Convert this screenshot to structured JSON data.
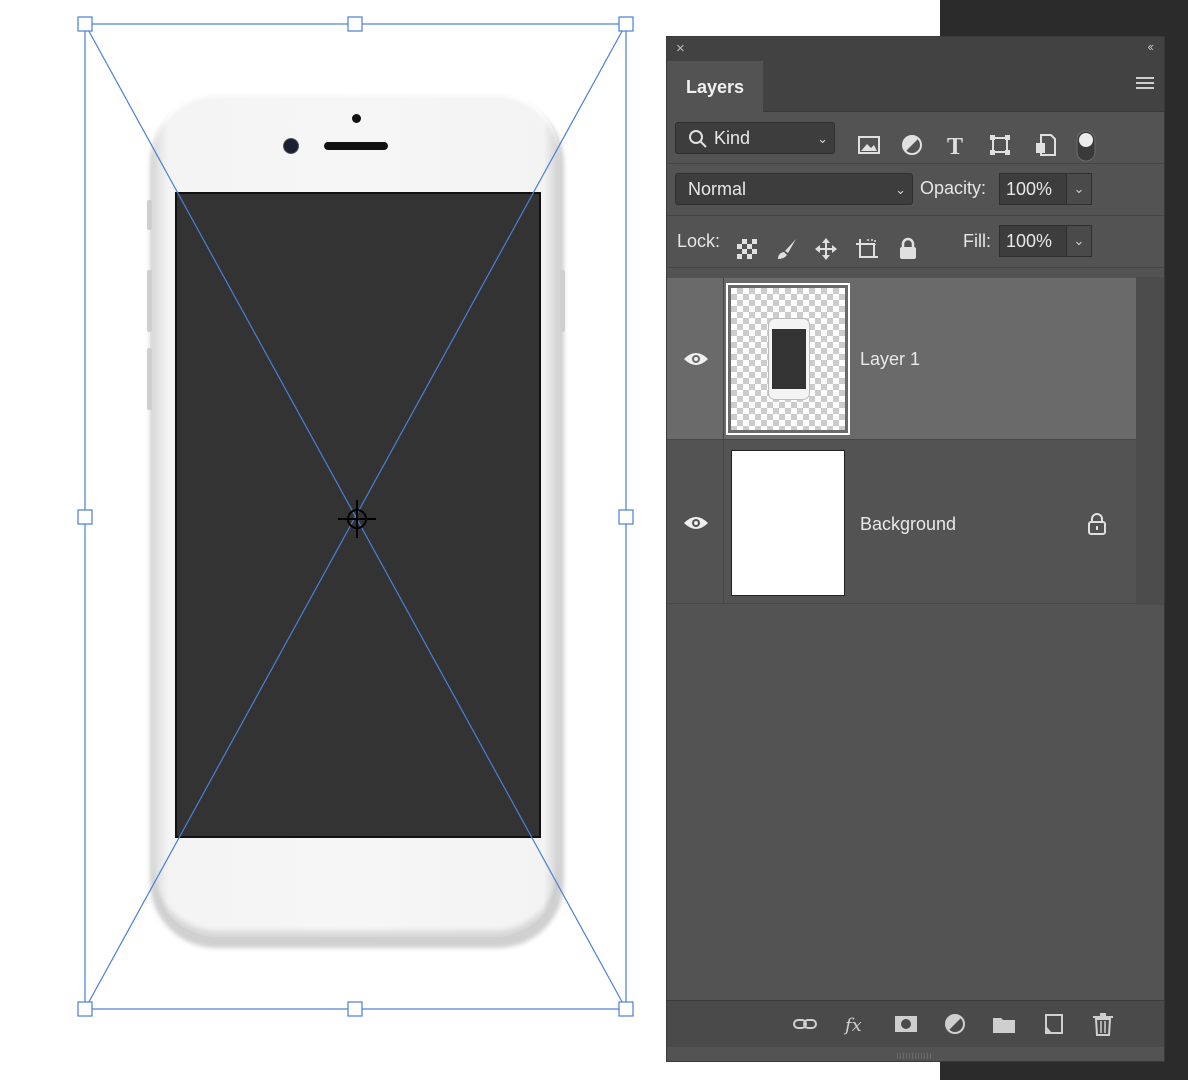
{
  "panel": {
    "close_label": "×",
    "collapse_label": "‹‹",
    "tab_label": "Layers",
    "filter": {
      "kind_label": "Kind"
    },
    "blend_mode": "Normal",
    "opacity_label": "Opacity:",
    "opacity_value": "100%",
    "lock_label": "Lock:",
    "fill_label": "Fill:",
    "fill_value": "100%",
    "layers": [
      {
        "name": "Layer 1",
        "visible": true,
        "selected": true
      },
      {
        "name": "Background",
        "visible": true,
        "locked": true
      }
    ]
  },
  "colors": {
    "panel_bg": "#535353",
    "selected_row": "#6a6a6a",
    "transform_line": "#4a7fd6",
    "screen": "#333333"
  },
  "icons": [
    "search-icon",
    "image-filter-icon",
    "adjustment-filter-icon",
    "type-filter-icon",
    "shape-filter-icon",
    "smart-object-filter-icon",
    "filter-toggle-icon",
    "lock-transparent-icon",
    "lock-image-icon",
    "lock-position-icon",
    "lock-artboard-icon",
    "lock-all-icon",
    "eye-icon",
    "lock-icon",
    "link-icon",
    "fx-icon",
    "mask-icon",
    "adjustment-icon",
    "folder-icon",
    "new-layer-icon",
    "trash-icon"
  ]
}
